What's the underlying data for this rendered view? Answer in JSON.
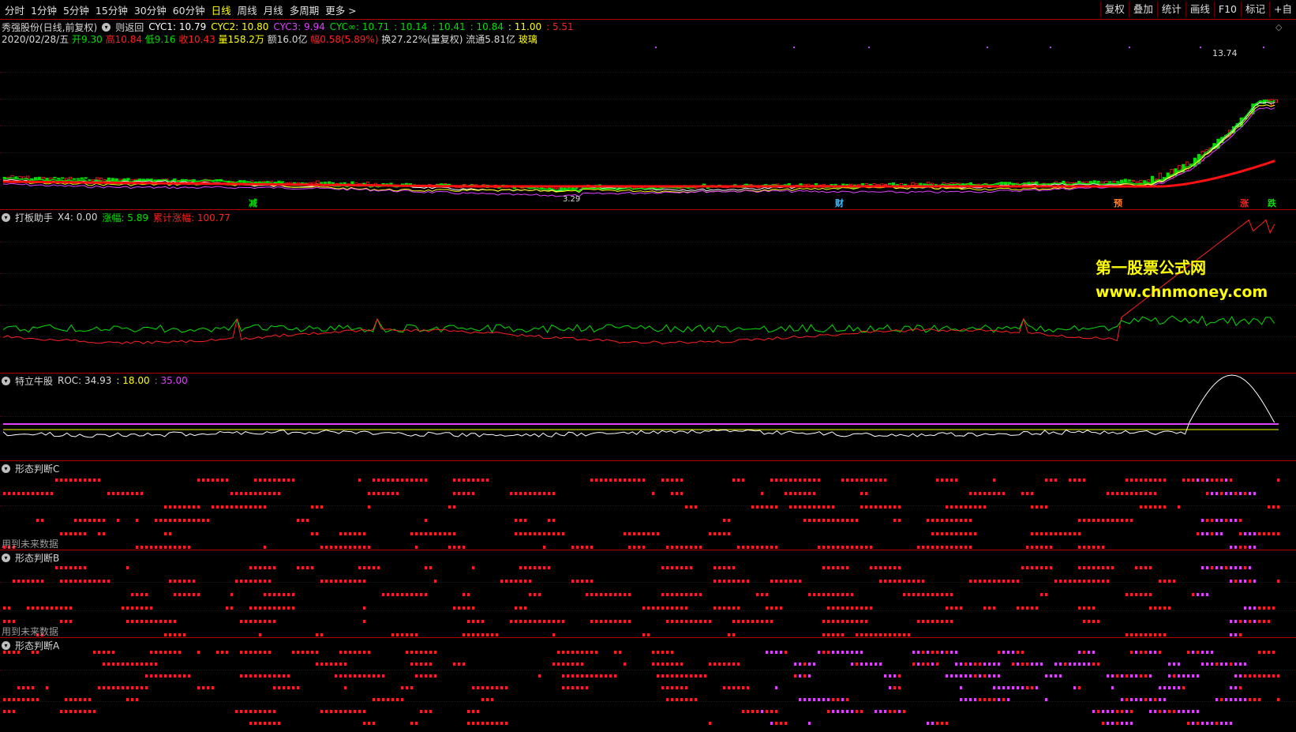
{
  "periods": [
    "分时",
    "1分钟",
    "5分钟",
    "15分钟",
    "30分钟",
    "60分钟",
    "日线",
    "周线",
    "月线",
    "多周期",
    "更多 >"
  ],
  "active_period": "日线",
  "tools": [
    "复权",
    "叠加",
    "统计",
    "画线",
    "F10",
    "标记",
    "+自"
  ],
  "main": {
    "title": "秀强股份(日线,前复权)",
    "indicator": "则返回",
    "cyc1": "CYC1: 10.79",
    "cyc2": "CYC2: 10.80",
    "cyc3": "CYC3: 9.94",
    "cycinf": "CYC∞: 10.71",
    "v1": ": 10.14",
    "v2": ": 10.41",
    "v3": ": 10.84",
    "v4": ": 11.00",
    "v5": ": 5.51",
    "date": "2020/02/28/五",
    "open": "开9.30",
    "high": "高10.84",
    "low": "低9.16",
    "close": "收10.43",
    "volume": "量158.2万",
    "amount": "额16.0亿",
    "amp": "幅0.58(5.89%)",
    "turnover": "换27.22%(量复权)",
    "float": "流通5.81亿",
    "concept": "玻璃",
    "peak_label": "13.74",
    "low_label": "3.29",
    "markers": [
      "减",
      "财",
      "预",
      "涨",
      "跌"
    ]
  },
  "panel1": {
    "name": "打板助手",
    "x4": "X4: 0.00",
    "zf": "涨幅: 5.89",
    "ljzf": "累计涨幅: 100.77"
  },
  "panel2": {
    "name": "特立牛股",
    "roc": "ROC: 34.93",
    "a": ": 18.00",
    "b": ": 35.00"
  },
  "panel3": {
    "name": "形态判断C",
    "future": "用到未来数据"
  },
  "panel4": {
    "name": "形态判断B",
    "future": "用到未来数据"
  },
  "panel5": {
    "name": "形态判断A"
  },
  "watermark": {
    "line1": "第一股票公式网",
    "line2": "www.chnmoney.com"
  },
  "colors": {
    "red": "#ff2020",
    "green": "#00e000",
    "magenta": "#e040ff",
    "yellow": "#ffff00",
    "white": "#ffffff",
    "cyan": "#40c0ff"
  }
}
